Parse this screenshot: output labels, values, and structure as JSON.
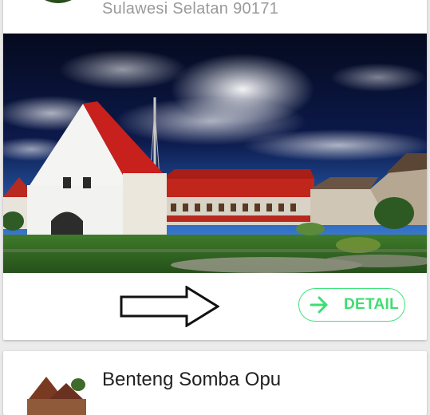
{
  "card1": {
    "subtitle": "Sulawesi Selatan 90171",
    "detail_label": "DETAIL"
  },
  "card2": {
    "title": "Benteng Somba Opu"
  },
  "icons": {
    "avatar": "place-avatar",
    "next": "right-arrow-outline-icon",
    "detail": "arrow-right-icon"
  },
  "colors": {
    "accent": "#3fe37a",
    "subtitle_text": "#9a9a9a",
    "roof_red": "#c0261c"
  }
}
